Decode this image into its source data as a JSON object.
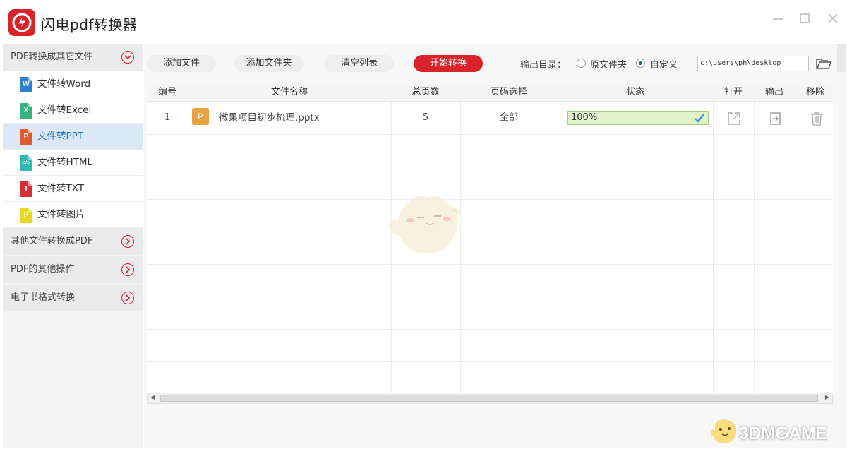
{
  "app": {
    "title": "闪电pdf转换器",
    "brand_color": "#d8232a"
  },
  "window_controls": [
    "minimize-icon",
    "maximize-icon",
    "close-icon"
  ],
  "sidebar": {
    "categories": [
      {
        "label": "PDF转换成其它文件",
        "icon": "chevron-down-circle-icon",
        "expanded": true
      },
      {
        "label": "其他文件转换成PDF",
        "icon": "chevron-right-circle-icon",
        "expanded": false
      },
      {
        "label": "PDF的其他操作",
        "icon": "chevron-right-circle-icon",
        "expanded": false
      },
      {
        "label": "电子书格式转换",
        "icon": "chevron-right-circle-icon",
        "expanded": false
      }
    ],
    "items": [
      {
        "label": "文件转Word",
        "icon_letter": "W",
        "color": "#2f7fd0",
        "active": false
      },
      {
        "label": "文件转Excel",
        "icon_letter": "X",
        "color": "#36b37e",
        "active": false
      },
      {
        "label": "文件转PPT",
        "icon_letter": "P",
        "color": "#e05a32",
        "active": true
      },
      {
        "label": "文件转HTML",
        "icon_letter": "</>",
        "color": "#2fb8b0",
        "active": false
      },
      {
        "label": "文件转TXT",
        "icon_letter": "T",
        "color": "#d6313b",
        "active": false
      },
      {
        "label": "文件转图片",
        "icon_letter": "P",
        "color": "#e9d81e",
        "active": false
      }
    ]
  },
  "toolbar": {
    "add_file": "添加文件",
    "add_folder": "添加文件夹",
    "clear_list": "清空列表",
    "start": "开始转换",
    "output_label": "输出目录：",
    "option_original": "原文件夹",
    "option_custom": "自定义",
    "selected_option": "自定义",
    "output_path": "c:\\users\\ph\\desktop"
  },
  "table": {
    "columns": [
      "编号",
      "文件名称",
      "总页数",
      "页码选择",
      "状态",
      "打开",
      "输出",
      "移除"
    ],
    "rows": [
      {
        "index": "1",
        "file_icon_letter": "P",
        "file_name": "微果项目初步梳理.pptx",
        "pages": "5",
        "page_range": "全部",
        "status": "100%",
        "progress": 1.0
      }
    ]
  },
  "watermark": "3DMGAME"
}
